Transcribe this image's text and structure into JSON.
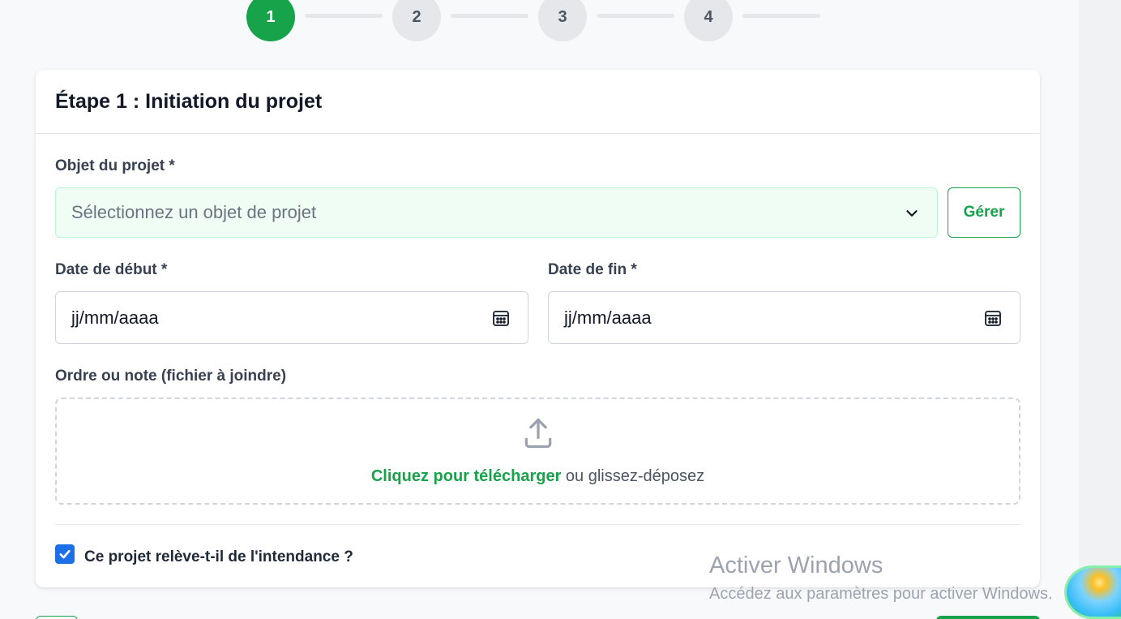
{
  "stepper": {
    "steps": [
      {
        "number": "1",
        "active": true
      },
      {
        "number": "2",
        "active": false
      },
      {
        "number": "3",
        "active": false
      },
      {
        "number": "4",
        "active": false
      }
    ]
  },
  "card": {
    "title": "Étape 1 : Initiation du projet",
    "project_object": {
      "label": "Objet du projet *",
      "placeholder": "Sélectionnez un objet de projet",
      "manage_label": "Gérer"
    },
    "start_date": {
      "label": "Date de début *",
      "placeholder": "jj/mm/aaaa"
    },
    "end_date": {
      "label": "Date de fin *",
      "placeholder": "jj/mm/aaaa"
    },
    "attachment": {
      "label": "Ordre ou note (fichier à joindre)",
      "link_text": "Cliquez pour télécharger",
      "rest_text": " ou glissez-déposez"
    },
    "stewardship": {
      "label": "Ce projet relève-t-il de l'intendance ?",
      "checked": true
    }
  },
  "watermark": {
    "title": "Activer Windows",
    "subtitle": "Accédez aux paramètres pour activer Windows."
  },
  "colors": {
    "accent": "#16a34a",
    "checkbox": "#1d6fe8",
    "select_bg": "#f0fdf4"
  }
}
